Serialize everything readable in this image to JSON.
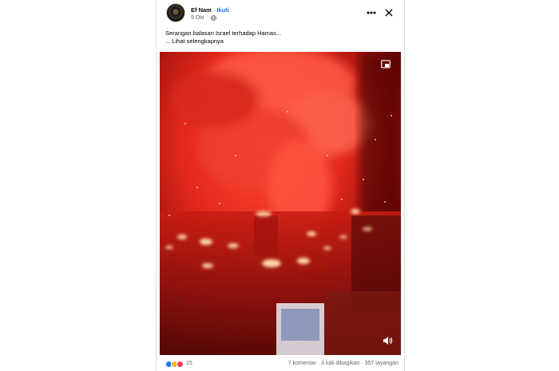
{
  "post": {
    "author": "Ef Nam",
    "separator": "·",
    "follow_label": "Ikuti",
    "date": "9 Okt",
    "separator2": "·",
    "caption_line": "Serangan balasan Israel terhadap Hamas...",
    "see_more_label": "... Lihat selengkapnya"
  },
  "reactions": {
    "icons": [
      "like-icon",
      "sad-icon",
      "love-icon"
    ],
    "colors": {
      "like": "#1877f2",
      "sad": "#f7b125",
      "love": "#f33e58"
    },
    "count": "15"
  },
  "stats": {
    "comments": "7 komentar",
    "shares": "3 kali dibagikan",
    "views": "357 tayangan",
    "sep": "·"
  },
  "colors": {
    "link": "#1877f2",
    "muted": "#65676b",
    "video_tint": "#e2281c"
  }
}
